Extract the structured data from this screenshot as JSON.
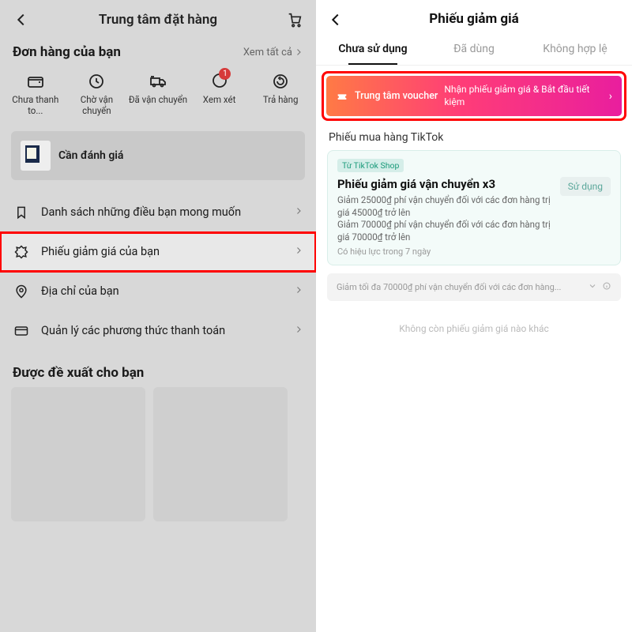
{
  "left": {
    "header_title": "Trung tâm đặt hàng",
    "orders_heading": "Đơn hàng của bạn",
    "see_all": "Xem tất cả",
    "statuses": [
      {
        "label": "Chưa thanh to..."
      },
      {
        "label": "Chờ vận chuyển"
      },
      {
        "label": "Đã vận chuyển"
      },
      {
        "label": "Xem xét",
        "badge": "1"
      },
      {
        "label": "Trả hàng"
      }
    ],
    "review_prompt": "Cần đánh giá",
    "menu": [
      {
        "label": "Danh sách những điều bạn mong muốn",
        "icon": "bookmark"
      },
      {
        "label": "Phiếu giảm giá của bạn",
        "icon": "coupon",
        "highlight": true
      },
      {
        "label": "Địa chỉ của bạn",
        "icon": "location"
      },
      {
        "label": "Quản lý các phương thức thanh toán",
        "icon": "card"
      }
    ],
    "recommend_heading": "Được đề xuất cho bạn"
  },
  "right": {
    "header_title": "Phiếu giảm giá",
    "tabs": [
      {
        "label": "Chưa sử dụng",
        "active": true
      },
      {
        "label": "Đã dùng"
      },
      {
        "label": "Không hợp lệ"
      }
    ],
    "banner": {
      "left": "Trung tâm voucher",
      "right": "Nhận phiếu giảm giá & Bắt đầu tiết kiệm"
    },
    "section_label": "Phiếu mua hàng TikTok",
    "coupon": {
      "tag": "Từ TikTok Shop",
      "title": "Phiếu giảm giá vận chuyển x3",
      "line1": "Giảm 25000₫ phí vận chuyển đối với các đơn hàng trị giá 45000₫ trở lên",
      "line2": "Giảm 70000₫ phí vận chuyển đối với các đơn hàng trị giá 70000₫ trở lên",
      "valid": "Có hiệu lực trong 7 ngày",
      "use_label": "Sử dụng"
    },
    "coupon_footer": "Giảm tối đa 70000₫ phí vận chuyển đối với các đơn hàng...",
    "no_more": "Không còn phiếu giảm giá nào khác"
  }
}
